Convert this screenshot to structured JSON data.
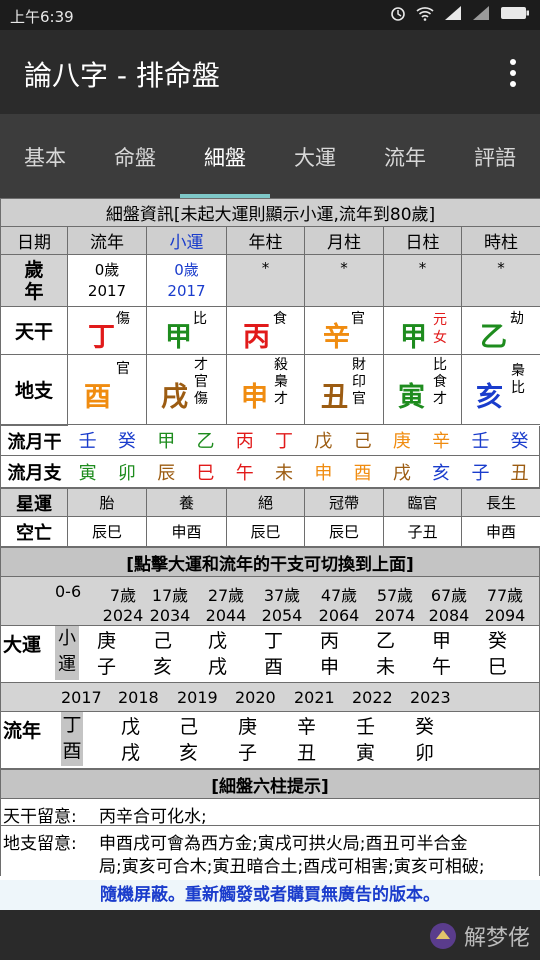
{
  "status": {
    "time": "上午6:39"
  },
  "app": {
    "title": "論八字 - 排命盤"
  },
  "tabs": [
    "基本",
    "命盤",
    "細盤",
    "大運",
    "流年",
    "評語"
  ],
  "table_title": "細盤資訊[未起大運則顯示小運,流年到80歲]",
  "col_headers": [
    "日期",
    "流年",
    "小運",
    "年柱",
    "月柱",
    "日柱",
    "時柱"
  ],
  "age_row": {
    "label": "歲年",
    "liunian_age": "0歲",
    "liunian_year": "2017",
    "xiaoyun_age": "0歲",
    "xiaoyun_year": "2017",
    "stars": [
      "*",
      "*",
      "*",
      "*"
    ]
  },
  "tiangan": {
    "label": "天干",
    "cells": [
      {
        "char": "丁",
        "ten": "傷"
      },
      {
        "char": "甲",
        "ten": "比"
      },
      {
        "char": "丙",
        "ten": "食"
      },
      {
        "char": "辛",
        "ten": "官"
      },
      {
        "char": "甲",
        "ten": "元女"
      },
      {
        "char": "乙",
        "ten": "劫"
      }
    ]
  },
  "dizhi": {
    "label": "地支",
    "cells": [
      {
        "char": "酉",
        "ten": "官"
      },
      {
        "char": "戌",
        "ten": "才官傷"
      },
      {
        "char": "申",
        "ten": "殺梟才"
      },
      {
        "char": "丑",
        "ten": "財印官"
      },
      {
        "char": "寅",
        "ten": "比食才"
      },
      {
        "char": "亥",
        "ten": "梟比"
      }
    ]
  },
  "liuyue_gan": {
    "label": "流月干",
    "chars": [
      "壬",
      "癸",
      "甲",
      "乙",
      "丙",
      "丁",
      "戊",
      "己",
      "庚",
      "辛",
      "壬",
      "癸"
    ]
  },
  "liuyue_zhi": {
    "label": "流月支",
    "chars": [
      "寅",
      "卯",
      "辰",
      "巳",
      "午",
      "未",
      "申",
      "酉",
      "戌",
      "亥",
      "子",
      "丑"
    ]
  },
  "xingyun": {
    "label": "星運",
    "values": [
      "胎",
      "養",
      "絕",
      "冠帶",
      "臨官",
      "長生"
    ]
  },
  "kongwang": {
    "label": "空亡",
    "values": [
      "辰巳",
      "申酉",
      "辰巳",
      "辰巳",
      "子丑",
      "申酉"
    ]
  },
  "dayun_title": "[點擊大運和流年的干支可切換到上面]",
  "dayun_ages": [
    {
      "age": "0-6",
      "year": ""
    },
    {
      "age": "7歲",
      "year": "2024"
    },
    {
      "age": "17歲",
      "year": "2034"
    },
    {
      "age": "27歲",
      "year": "2044"
    },
    {
      "age": "37歲",
      "year": "2054"
    },
    {
      "age": "47歲",
      "year": "2064"
    },
    {
      "age": "57歲",
      "year": "2074"
    },
    {
      "age": "67歲",
      "year": "2084"
    },
    {
      "age": "77歲",
      "year": "2094"
    }
  ],
  "dayun": {
    "label": "大運",
    "first": "小運",
    "pillars": [
      {
        "gan": "庚",
        "zhi": "子"
      },
      {
        "gan": "己",
        "zhi": "亥"
      },
      {
        "gan": "戊",
        "zhi": "戌"
      },
      {
        "gan": "丁",
        "zhi": "酉"
      },
      {
        "gan": "丙",
        "zhi": "申"
      },
      {
        "gan": "乙",
        "zhi": "未"
      },
      {
        "gan": "甲",
        "zhi": "午"
      },
      {
        "gan": "癸",
        "zhi": "巳"
      }
    ]
  },
  "liunian_years": [
    "2017",
    "2018",
    "2019",
    "2020",
    "2021",
    "2022",
    "2023"
  ],
  "liunian": {
    "label": "流年",
    "pillars": [
      {
        "gan": "丁",
        "zhi": "酉"
      },
      {
        "gan": "戊",
        "zhi": "戌"
      },
      {
        "gan": "己",
        "zhi": "亥"
      },
      {
        "gan": "庚",
        "zhi": "子"
      },
      {
        "gan": "辛",
        "zhi": "丑"
      },
      {
        "gan": "壬",
        "zhi": "寅"
      },
      {
        "gan": "癸",
        "zhi": "卯"
      }
    ]
  },
  "hint_title": "[細盤六柱提示]",
  "tiangan_note": {
    "label": "天干留意:",
    "text": "丙辛合可化水;"
  },
  "dizhi_note": {
    "label": "地支留意:",
    "line1": "申酉戌可會為西方金;寅戌可拱火局;酉丑可半合金",
    "line2": "局;寅亥可合木;寅丑暗合土;酉戌可相害;寅亥可相破;"
  },
  "ad": "隨機屏蔽。重新觸發或者購買無廣告的版本。",
  "watermark": "解梦佬",
  "colors": {
    "wood": "#1e8c1e",
    "fire": "#e11a1a",
    "earth": "#9c5c12",
    "metal": "#f08c10",
    "water": "#1a3ccc",
    "tab_indicator": "#7ec8c8"
  }
}
